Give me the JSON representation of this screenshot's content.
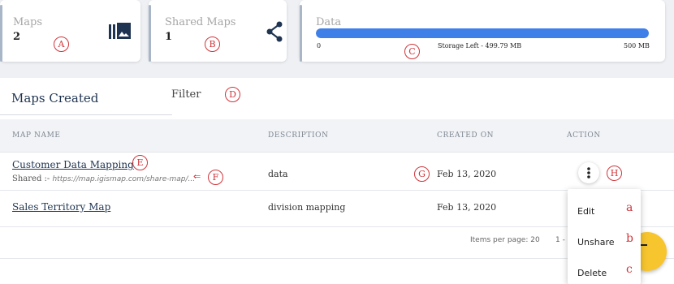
{
  "stats": {
    "maps": {
      "label": "Maps",
      "value": "2",
      "icon": "photo-library-icon"
    },
    "shared_maps": {
      "label": "Shared Maps",
      "value": "1",
      "icon": "share-icon"
    },
    "data": {
      "label": "Data",
      "min_label": "0",
      "max_label": "500 MB",
      "storage_left": "Storage Left - 499.79 MB",
      "used_fraction": 0.99958,
      "bar_color": "#3f7fe8"
    }
  },
  "panel": {
    "title": "Maps Created",
    "filter_label": "Filter"
  },
  "table": {
    "headers": [
      "MAP NAME",
      "DESCRIPTION",
      "CREATED ON",
      "ACTION"
    ],
    "rows": [
      {
        "name": "Customer Data Mapping",
        "shared_prefix": "Shared :-",
        "shared_url": "https://map.igismap.com/share-map/...",
        "description": "data",
        "created_on": "Feb 13, 2020"
      },
      {
        "name": "Sales Territory Map",
        "description": "division mapping",
        "created_on": "Feb 13, 2020"
      }
    ]
  },
  "paginator": {
    "items_per_page_label": "Items per page: 20",
    "range_label": "1 - 2"
  },
  "action_menu": {
    "items": [
      "Edit",
      "Unshare",
      "Delete"
    ]
  },
  "callouts": {
    "A": "A",
    "B": "B",
    "C": "C",
    "D": "D",
    "E": "E",
    "F": "F",
    "G": "G",
    "H": "H",
    "a": "a",
    "b": "b",
    "c": "c"
  },
  "colors": {
    "accent": "#3f7fe8",
    "callout": "#d0343a",
    "fab": "#f7c52e",
    "title": "#1f3450"
  }
}
